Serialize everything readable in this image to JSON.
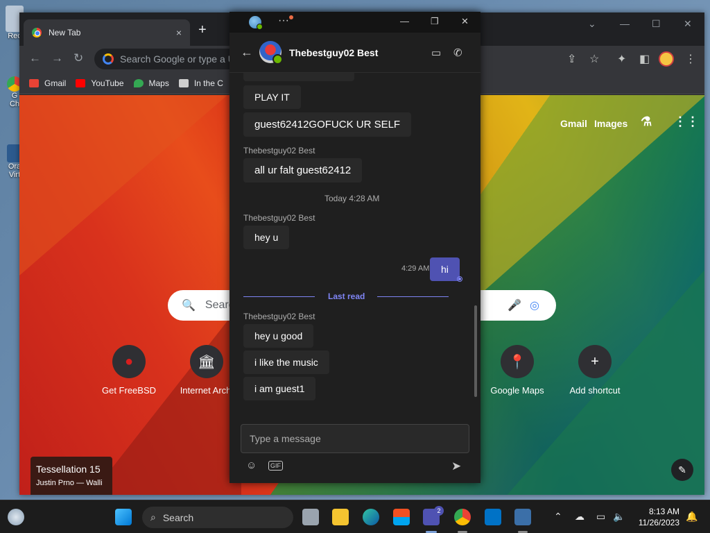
{
  "desktop": {
    "icon_labels": [
      "Rec",
      "G\nCh",
      "Ora\nVirt"
    ]
  },
  "chrome": {
    "tab_title": "New Tab",
    "tab_close": "×",
    "new_tab": "+",
    "omnibox_placeholder": "Search Google or type a U",
    "bookmarks": [
      {
        "label": "Gmail",
        "color": "#ea4335"
      },
      {
        "label": "YouTube",
        "color": "#ff0000"
      },
      {
        "label": "Maps",
        "color": "#34a853"
      },
      {
        "label": "In the C",
        "color": "#cfcfcf"
      }
    ],
    "ntp": {
      "links": [
        "Gmail",
        "Images"
      ],
      "search_placeholder": "Searc",
      "shortcuts": [
        {
          "label": "Get FreeBSD",
          "icon": "freebsd-icon",
          "glyph": "●"
        },
        {
          "label": "Internet Archi",
          "icon": "archive-icon",
          "glyph": "🏛"
        },
        {
          "label": "Google Maps",
          "icon": "maps-icon",
          "glyph": "📍"
        },
        {
          "label": "Add shortcut",
          "icon": "plus-icon",
          "glyph": "+"
        }
      ],
      "wallpaper_title": "Tessellation 15",
      "wallpaper_credit": "Justin Prno — Walli"
    }
  },
  "teams": {
    "contact_name": "Thebestguy02 Best",
    "messages_top": [
      {
        "text": "PLAY IT"
      },
      {
        "text": "guest62412GOFUCK UR SELF"
      }
    ],
    "group1": {
      "sender": "Thebestguy02 Best",
      "messages": [
        "all ur falt guest62412"
      ]
    },
    "day_divider": "Today 4:28 AM",
    "group2": {
      "sender": "Thebestguy02 Best",
      "messages": [
        "hey u"
      ]
    },
    "my_message": {
      "time": "4:29 AM",
      "text": "hi"
    },
    "last_read": "Last read",
    "group3": {
      "sender": "Thebestguy02 Best",
      "messages": [
        "hey u good",
        "i like the music",
        "i am guest1"
      ]
    },
    "compose_placeholder": "Type a message",
    "gif_label": "GIF"
  },
  "taskbar": {
    "search_label": "Search",
    "teams_badge": "2",
    "time": "8:13 AM",
    "date": "11/26/2023"
  }
}
